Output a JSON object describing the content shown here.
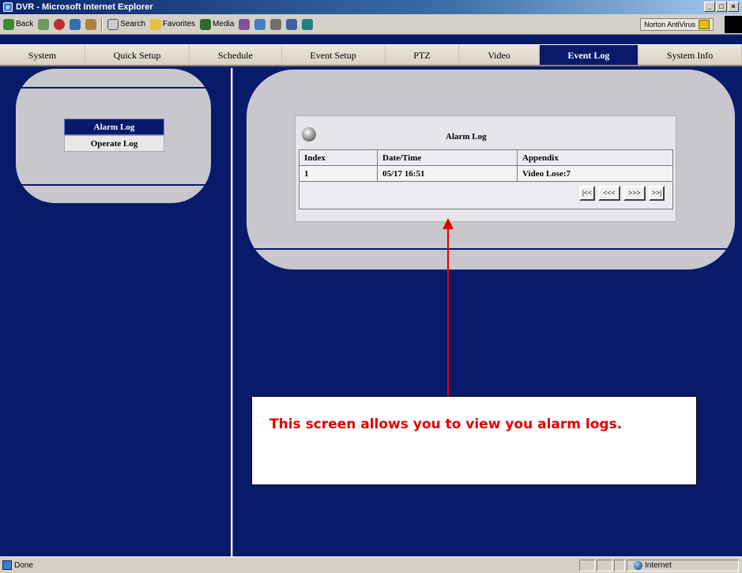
{
  "window": {
    "title": "DVR - Microsoft Internet Explorer",
    "controls": [
      "_",
      "□",
      "×"
    ]
  },
  "ie_toolbar": {
    "back": "Back",
    "search": "Search",
    "favorites": "Favorites",
    "media": "Media",
    "norton": "Norton AntiVirus"
  },
  "menu": {
    "items": [
      {
        "label": "System"
      },
      {
        "label": "Quick Setup"
      },
      {
        "label": "Schedule"
      },
      {
        "label": "Event Setup"
      },
      {
        "label": "PTZ"
      },
      {
        "label": "Video"
      },
      {
        "label": "Event Log",
        "active": true
      },
      {
        "label": "System Info"
      }
    ]
  },
  "sidebar": {
    "items": [
      {
        "label": "Alarm Log"
      },
      {
        "label": "Operate Log"
      }
    ]
  },
  "log": {
    "title": "Alarm Log",
    "columns": [
      "Index",
      "Date/Time",
      "Appendix"
    ],
    "rows": [
      {
        "index": "1",
        "datetime": "05/17 16:51",
        "appendix": "Video Lose:7"
      }
    ],
    "pager": {
      "first": "|<<",
      "prev": "<<<",
      "next": ">>>",
      "last": ">>|"
    }
  },
  "annotation": {
    "text": "This screen allows you to view you alarm logs.",
    "color": "#e00000"
  },
  "statusbar": {
    "status": "Done",
    "zone": "Internet"
  },
  "colors": {
    "background": "#0a1a6b",
    "panel": "#c8c8cc",
    "menu_active": "#0a1a6b"
  }
}
